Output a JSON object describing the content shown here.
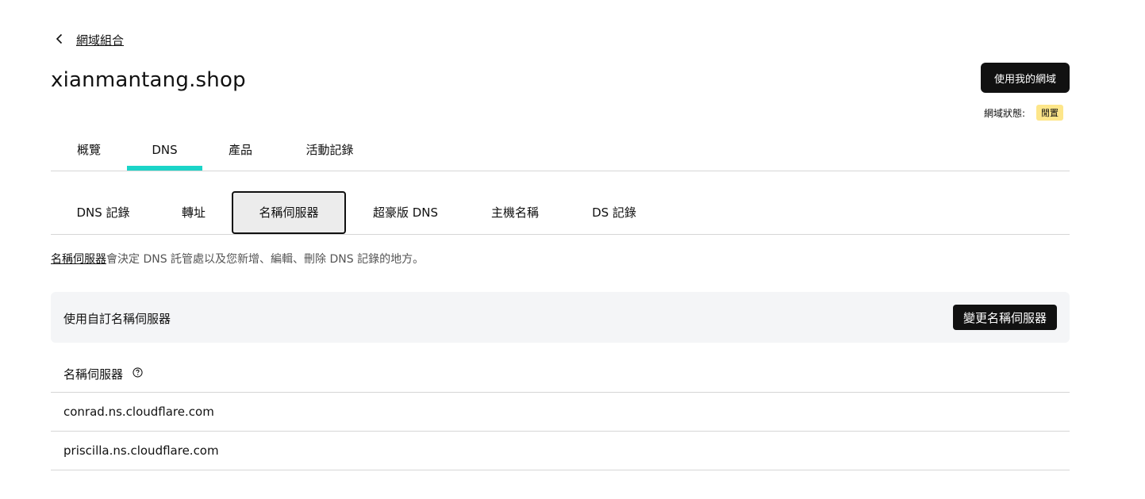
{
  "breadcrumb": {
    "back_label": "網域組合",
    "icon": "chevron-left-icon"
  },
  "domain": {
    "name": "xianmantang.shop"
  },
  "actions": {
    "use_domain_label": "使用我的網域"
  },
  "status": {
    "label": "網域狀態:",
    "value": "閒置",
    "badge_color": "#fde68a"
  },
  "tabs": [
    {
      "label": "概覽",
      "active": false
    },
    {
      "label": "DNS",
      "active": true
    },
    {
      "label": "產品",
      "active": false
    },
    {
      "label": "活動記錄",
      "active": false
    }
  ],
  "accent_color": "#1bd4c8",
  "subtabs": [
    {
      "label": "DNS 記錄",
      "active": false
    },
    {
      "label": "轉址",
      "active": false
    },
    {
      "label": "名稱伺服器",
      "active": true
    },
    {
      "label": "超豪版 DNS",
      "active": false
    },
    {
      "label": "主機名稱",
      "active": false
    },
    {
      "label": "DS 記錄",
      "active": false
    }
  ],
  "description": {
    "link": "名稱伺服器",
    "text": "會決定 DNS 託管處以及您新增、編輯、刪除 DNS 記錄的地方。"
  },
  "panel": {
    "label": "使用自訂名稱伺服器",
    "button_label": "變更名稱伺服器"
  },
  "nameservers": {
    "header": "名稱伺服器",
    "help_icon": "question-circle-icon",
    "rows": [
      "conrad.ns.cloudflare.com",
      "priscilla.ns.cloudflare.com"
    ]
  }
}
